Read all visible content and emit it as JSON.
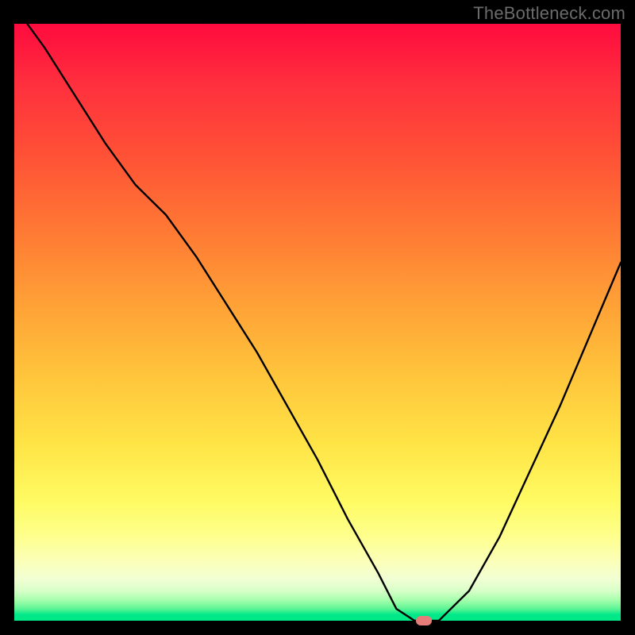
{
  "watermark": "TheBottleneck.com",
  "chart_data": {
    "type": "line",
    "title": "",
    "xlabel": "",
    "ylabel": "",
    "xlim": [
      0,
      100
    ],
    "ylim": [
      0,
      100
    ],
    "x": [
      0,
      5,
      10,
      15,
      20,
      25,
      30,
      35,
      40,
      45,
      50,
      55,
      60,
      63,
      66,
      70,
      75,
      80,
      85,
      90,
      95,
      100
    ],
    "values": [
      103,
      96,
      88,
      80,
      73,
      68,
      61,
      53,
      45,
      36,
      27,
      17,
      8,
      2,
      0,
      0,
      5,
      14,
      25,
      36,
      48,
      60
    ],
    "marker": {
      "x": 67.5,
      "y": 0
    },
    "gradient_stops": [
      {
        "pos": 0.0,
        "color": "#ff0b3e"
      },
      {
        "pos": 0.1,
        "color": "#ff2f3e"
      },
      {
        "pos": 0.22,
        "color": "#ff5136"
      },
      {
        "pos": 0.34,
        "color": "#ff7734"
      },
      {
        "pos": 0.46,
        "color": "#ff9e36"
      },
      {
        "pos": 0.58,
        "color": "#ffc23b"
      },
      {
        "pos": 0.7,
        "color": "#ffe345"
      },
      {
        "pos": 0.8,
        "color": "#fffb63"
      },
      {
        "pos": 0.86,
        "color": "#feff8e"
      },
      {
        "pos": 0.9,
        "color": "#fbffb8"
      },
      {
        "pos": 0.93,
        "color": "#f2ffd4"
      },
      {
        "pos": 0.95,
        "color": "#d7ffc8"
      },
      {
        "pos": 0.965,
        "color": "#a8ffad"
      },
      {
        "pos": 0.98,
        "color": "#5cf595"
      },
      {
        "pos": 0.99,
        "color": "#00e889"
      },
      {
        "pos": 1.0,
        "color": "#00e988"
      }
    ]
  }
}
